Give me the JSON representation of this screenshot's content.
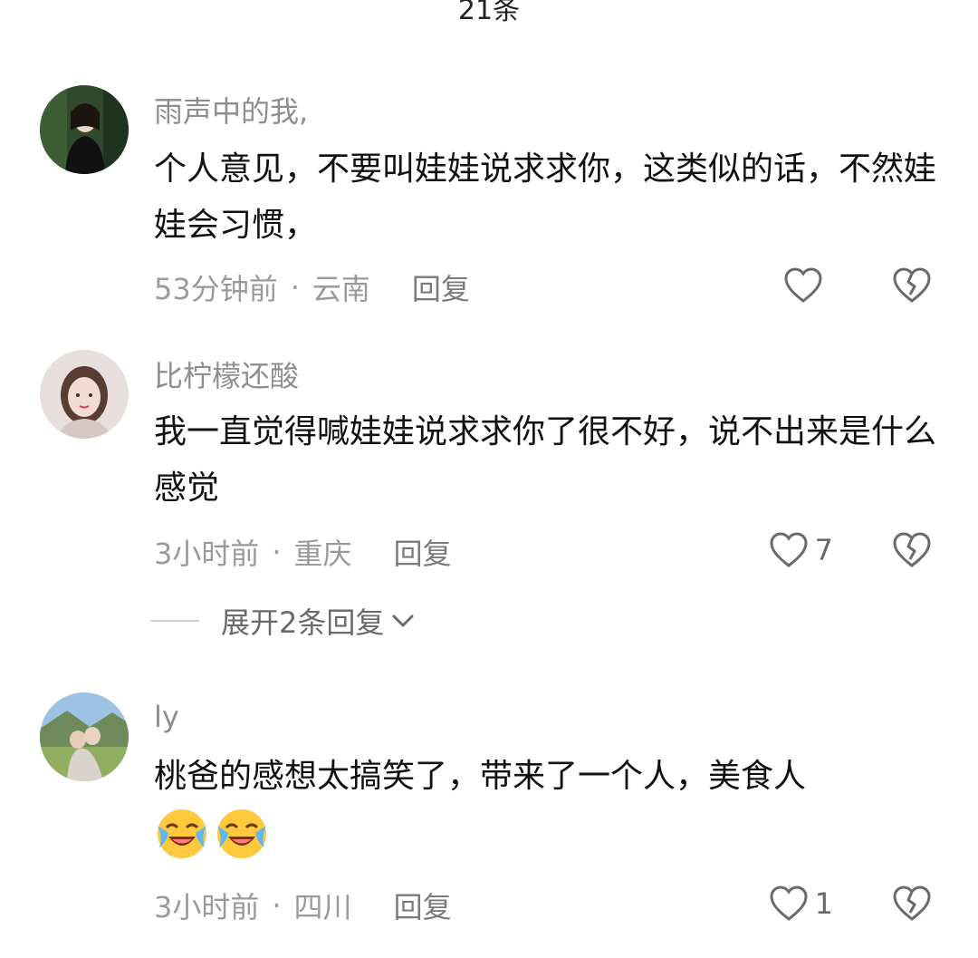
{
  "header": {
    "count_text": "21条"
  },
  "comments": [
    {
      "username": "雨声中的我,",
      "content": "个人意见，不要叫娃娃说求求你，这类似的话，不然娃娃会习惯，",
      "time": "53分钟前",
      "location": "云南",
      "reply_label": "回复",
      "likes": ""
    },
    {
      "username": "比柠檬还酸",
      "content": "我一直觉得喊娃娃说求求你了很不好，说不出来是什么感觉",
      "time": "3小时前",
      "location": "重庆",
      "reply_label": "回复",
      "likes": "7"
    },
    {
      "username": "ly",
      "content": "桃爸的感想太搞笑了，带来了一个人，美食人",
      "time": "3小时前",
      "location": "四川",
      "reply_label": "回复",
      "likes": "1"
    }
  ],
  "expand": {
    "label": "展开2条回复"
  },
  "icons": {
    "like": "heart-outline-icon",
    "dislike": "broken-heart-icon",
    "expand": "chevron-down-icon",
    "emoji": "laughing-crying-emoji"
  },
  "colors": {
    "username": "#8e8e8e",
    "meta": "#9a9a9a",
    "text": "#111111",
    "icon": "#6a6a6a"
  }
}
